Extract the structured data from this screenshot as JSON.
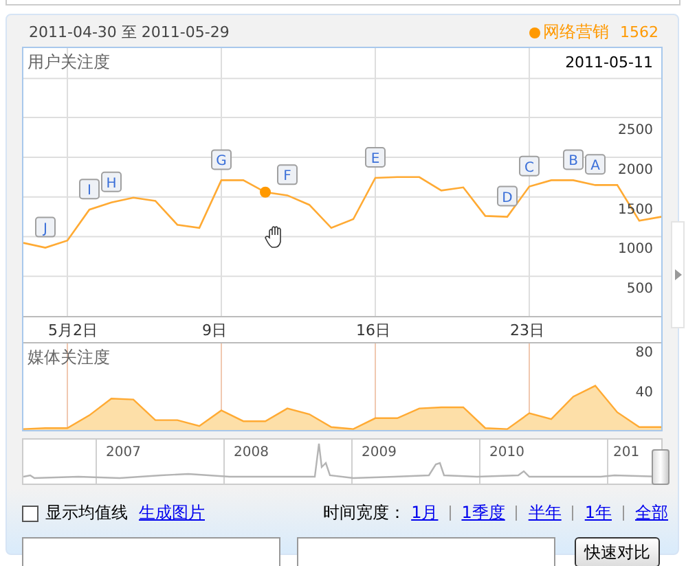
{
  "header": {
    "start": "2011-04-30",
    "separator": "至",
    "end": "2011-05-29",
    "legend": {
      "value": "1562",
      "color": "#ff9900"
    }
  },
  "user_chart": {
    "title": "用户关注度",
    "hover_date": "2011-05-11",
    "chart_data": {
      "type": "line",
      "x": [
        0,
        1,
        2,
        3,
        4,
        5,
        6,
        7,
        8,
        9,
        10,
        11,
        12,
        13,
        14,
        15,
        16,
        17,
        18,
        19,
        20,
        21,
        22,
        23,
        24,
        25,
        26,
        27,
        28,
        29
      ],
      "series": [
        {
          "name": "网络营销",
          "color": "#ffaa33",
          "values": [
            920,
            860,
            950,
            1340,
            1430,
            1490,
            1450,
            1150,
            1110,
            1710,
            1710,
            1560,
            1520,
            1400,
            1110,
            1220,
            1740,
            1750,
            1750,
            1580,
            1620,
            1260,
            1250,
            1630,
            1710,
            1710,
            1650,
            1650,
            1200,
            1250
          ]
        },
        {
          "color": "#ff9900",
          "marker": "circle",
          "values": [
            null,
            null,
            null,
            null,
            null,
            null,
            null,
            null,
            null,
            null,
            null,
            1560,
            null,
            null,
            null,
            null,
            null,
            null,
            null,
            null,
            null,
            null,
            null,
            null,
            null,
            null,
            null,
            null,
            null,
            null
          ]
        }
      ],
      "xlim": [
        0,
        29
      ],
      "xticks": [
        {
          "value": 2,
          "label": "5月2日"
        },
        {
          "value": 9,
          "label": "9日"
        },
        {
          "value": 16,
          "label": "16日"
        },
        {
          "value": 23,
          "label": "23日"
        }
      ],
      "yticks": [
        500,
        1000,
        1500,
        2000,
        2500
      ],
      "ylim": [
        0,
        3000
      ],
      "grid": true,
      "annotations": [
        {
          "text": "J",
          "x": 1
        },
        {
          "text": "I",
          "x": 3
        },
        {
          "text": "H",
          "x": 4
        },
        {
          "text": "G",
          "x": 9
        },
        {
          "text": "F",
          "x": 12
        },
        {
          "text": "E",
          "x": 16
        },
        {
          "text": "D",
          "x": 22
        },
        {
          "text": "C",
          "x": 23
        },
        {
          "text": "B",
          "x": 25
        },
        {
          "text": "A",
          "x": 26
        }
      ]
    }
  },
  "media_chart": {
    "title": "媒体关注度",
    "chart_data": {
      "type": "area",
      "x": [
        0,
        1,
        2,
        3,
        4,
        5,
        6,
        7,
        8,
        9,
        10,
        11,
        12,
        13,
        14,
        15,
        16,
        17,
        18,
        19,
        20,
        21,
        22,
        23,
        24,
        25,
        26,
        27,
        28,
        29
      ],
      "series": [
        {
          "color": "#ffaa33",
          "values": [
            1,
            2,
            2,
            15,
            32,
            31,
            10,
            10,
            4,
            20,
            9,
            9,
            22,
            16,
            3,
            1,
            12,
            12,
            22,
            23,
            23,
            2,
            1,
            17,
            11,
            34,
            45,
            18,
            3,
            3
          ]
        }
      ],
      "xlim": [
        0,
        29
      ],
      "yticks": [
        40,
        80
      ],
      "ylim": [
        0,
        88
      ],
      "grid": true
    }
  },
  "overview": {
    "years": [
      "2007",
      "2008",
      "2009",
      "2010",
      "201"
    ]
  },
  "footer": {
    "average_line": {
      "label": "显示均值线",
      "checked": false
    },
    "image_link": "生成图片",
    "span_label": "时间宽度：",
    "spans": [
      "1月",
      "1季度",
      "半年",
      "1年",
      "全部"
    ],
    "compare_button": "快速对比"
  }
}
